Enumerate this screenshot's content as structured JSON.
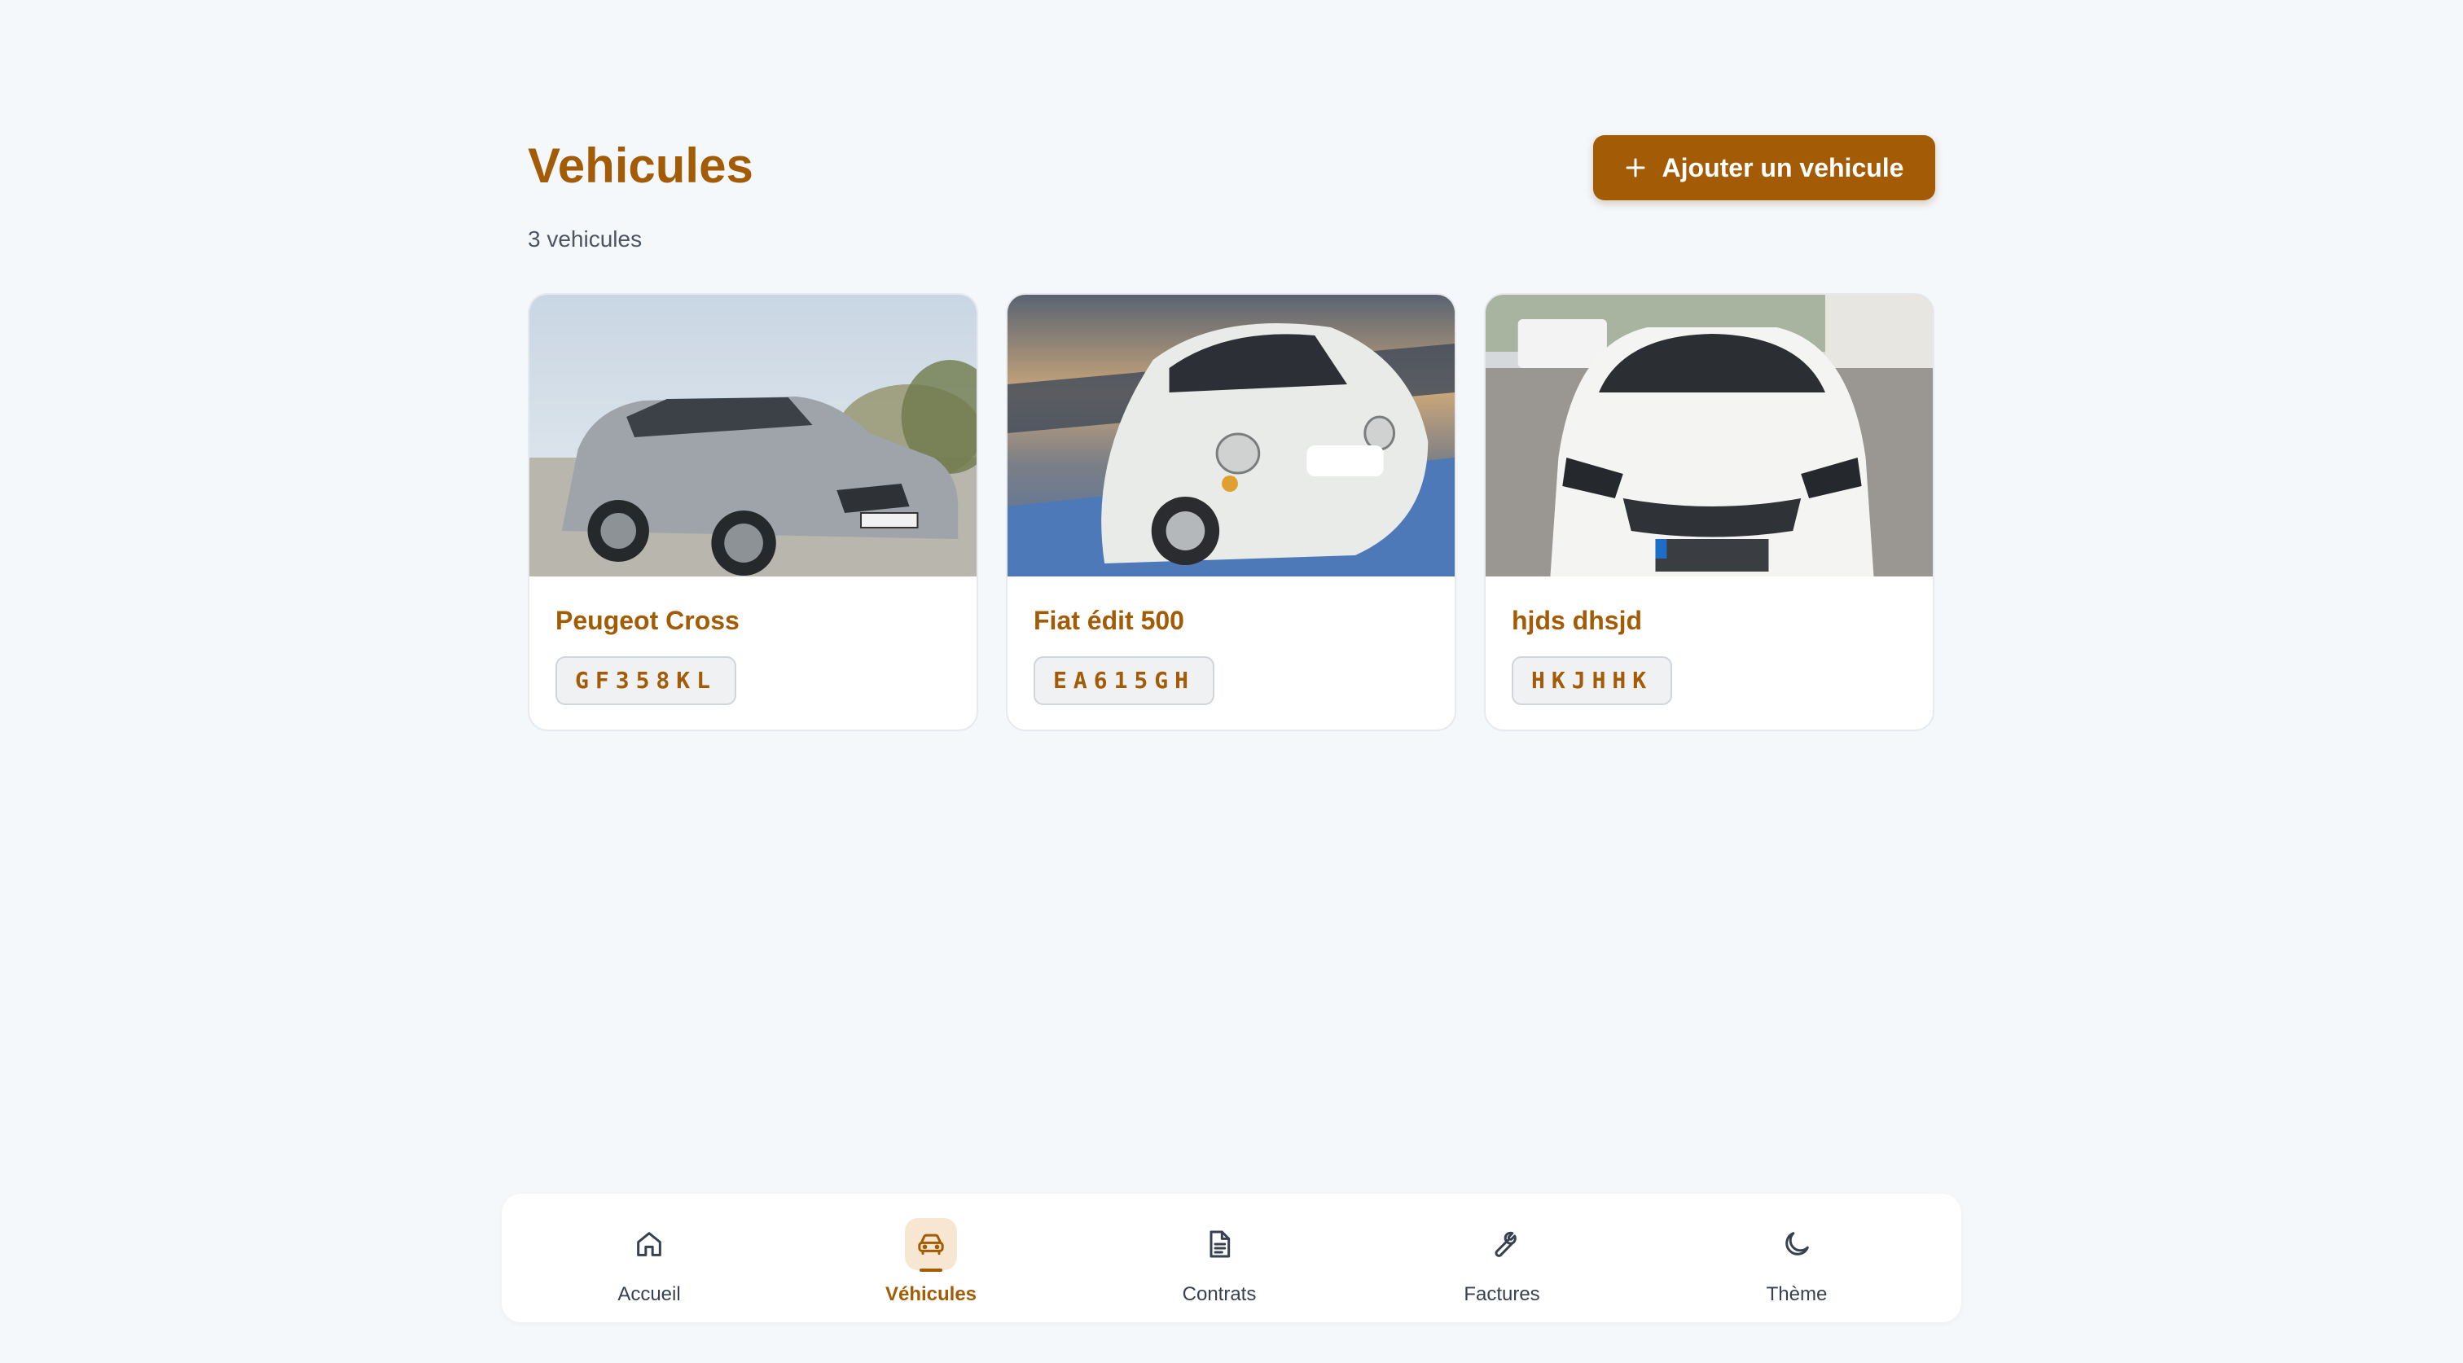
{
  "header": {
    "title": "Vehicules",
    "add_button_label": "Ajouter un vehicule",
    "count_label": "3 vehicules"
  },
  "vehicles": [
    {
      "name": "Peugeot Cross",
      "plate": "GF358KL"
    },
    {
      "name": "Fiat édit 500",
      "plate": "EA615GH"
    },
    {
      "name": "hjds dhsjd",
      "plate": "HKJHHK"
    }
  ],
  "nav": {
    "items": [
      {
        "label": "Accueil",
        "icon": "home-icon"
      },
      {
        "label": "Véhicules",
        "icon": "car-icon",
        "active": true
      },
      {
        "label": "Contrats",
        "icon": "document-icon"
      },
      {
        "label": "Factures",
        "icon": "wrench-icon"
      },
      {
        "label": "Thème",
        "icon": "moon-icon"
      }
    ]
  },
  "colors": {
    "accent": "#a35c05",
    "background": "#f5f8fb",
    "active_nav_bg": "#f7e7d2"
  }
}
